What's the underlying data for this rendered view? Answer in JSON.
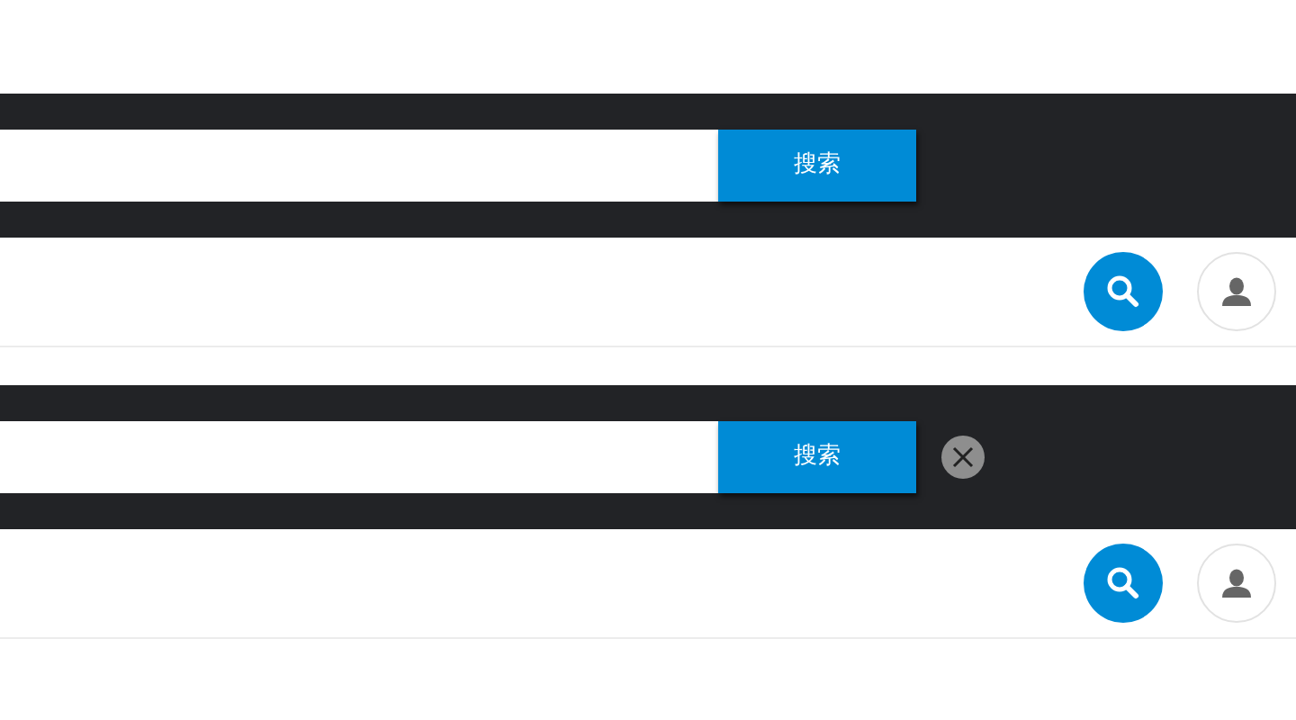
{
  "panels": [
    {
      "search_button": "搜索",
      "clear_button": false
    },
    {
      "search_button": "搜索",
      "clear_button": true
    }
  ]
}
